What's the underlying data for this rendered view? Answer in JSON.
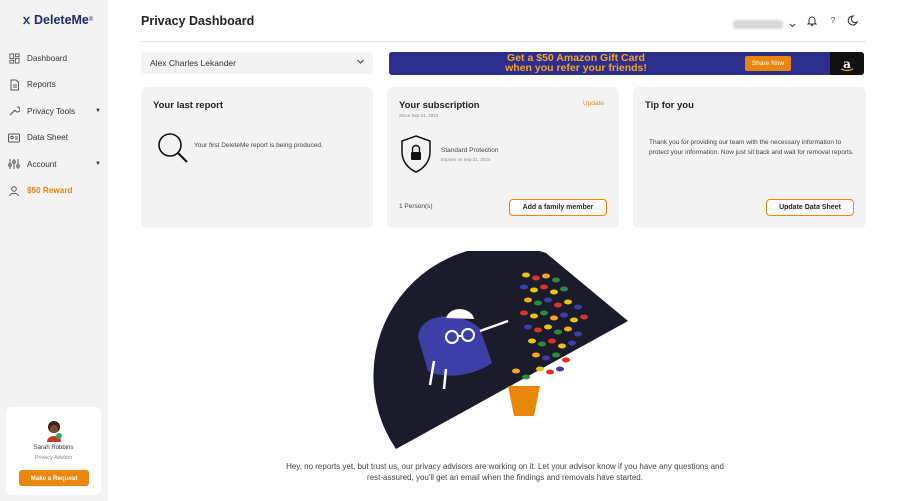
{
  "brand": {
    "name": "DeleteMe",
    "mark": "®"
  },
  "sidebar": {
    "items": [
      {
        "label": "Dashboard",
        "icon": "dashboard-icon"
      },
      {
        "label": "Reports",
        "icon": "document-icon"
      },
      {
        "label": "Privacy Tools",
        "icon": "wrench-icon",
        "has_caret": true
      },
      {
        "label": "Data Sheet",
        "icon": "id-card-icon"
      },
      {
        "label": "Account",
        "icon": "sliders-icon",
        "has_caret": true
      },
      {
        "label": "$50 Reward",
        "icon": "user-icon",
        "highlight": "#e8870c"
      }
    ],
    "advisor": {
      "name": "Sarah Robbins",
      "role": "Privacy Advisor",
      "button": "Make a Request"
    }
  },
  "header": {
    "title": "Privacy Dashboard",
    "user_email_hidden": "blurred",
    "icons": [
      "bell-icon",
      "help-icon",
      "theme-toggle-icon"
    ],
    "help_glyph": "?"
  },
  "profile_select": {
    "value": "Alex Charles Lekander"
  },
  "banner": {
    "line1": "Get a $50 Amazon Gift Card",
    "line2": "when you refer your friends!",
    "button": "Share Now",
    "logo_letter": "a",
    "bg": "#2c2d8c",
    "accent": "#f5a623"
  },
  "cards": {
    "last_report": {
      "title": "Your last report",
      "message": "Your first DeleteMe report is being produced."
    },
    "subscription": {
      "title": "Your subscription",
      "since": "Since Sep 21, 2023",
      "update_link": "Update",
      "plan": "Standard Protection",
      "expires": "Expires on Sep 21, 2024",
      "persons": "1 Person(s)",
      "button": "Add a family member"
    },
    "tip": {
      "title": "Tip for you",
      "text": "Thank you for providing our team with the necessary information to protect your information. Now just sit back and wait for removal reports.",
      "button": "Update Data Sheet"
    }
  },
  "empty_state": {
    "line1": "Hey, no reports yet, but trust us, our privacy advisors are working on it. Let your advisor know if you have any questions and",
    "line2": "rest-assured, you'll get an email when the findings and removals have started."
  },
  "colors": {
    "accent": "#e8870c",
    "sidebar_bg": "#f3f3f3",
    "card_bg": "#f3f3f3",
    "navy": "#1f2a6b"
  }
}
